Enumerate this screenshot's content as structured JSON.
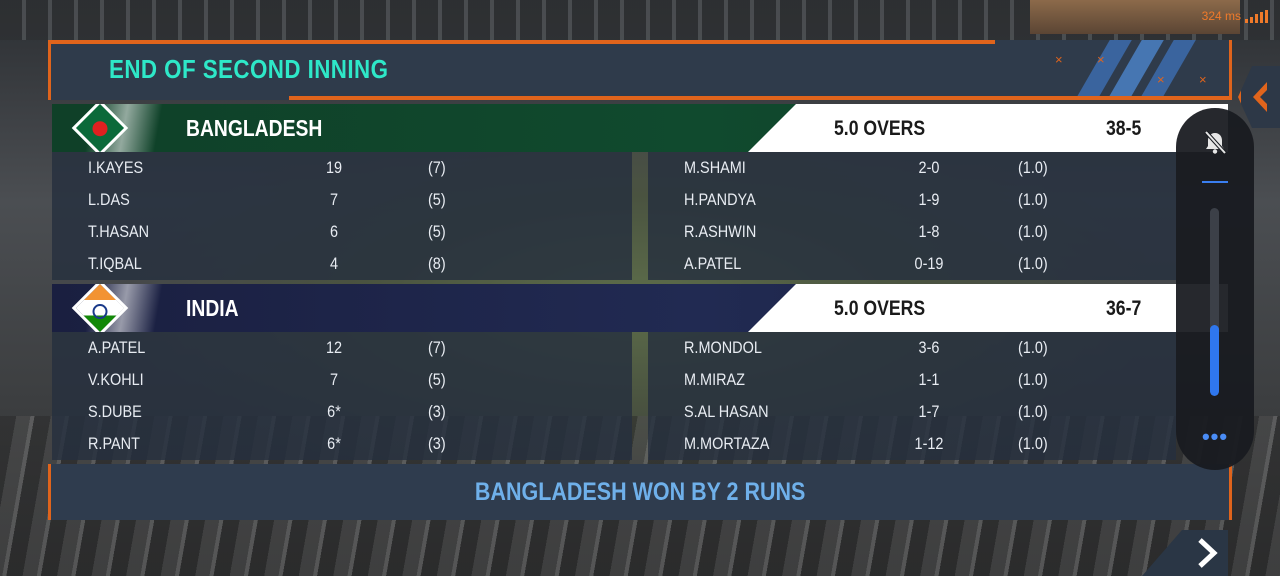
{
  "status": {
    "ping": "324 ms"
  },
  "header": {
    "title": "END OF SECOND INNING"
  },
  "teams": [
    {
      "name": "BANGLADESH",
      "overs": "5.0 OVERS",
      "score": "38-5",
      "flag_icon": "bangladesh-flag-icon",
      "batting": [
        {
          "name": "I.KAYES",
          "runs": "19",
          "balls": "(7)"
        },
        {
          "name": "L.DAS",
          "runs": "7",
          "balls": "(5)"
        },
        {
          "name": "T.HASAN",
          "runs": "6",
          "balls": "(5)"
        },
        {
          "name": "T.IQBAL",
          "runs": "4",
          "balls": "(8)"
        }
      ],
      "bowling": [
        {
          "name": "M.SHAMI",
          "figures": "2-0",
          "overs": "(1.0)"
        },
        {
          "name": "H.PANDYA",
          "figures": "1-9",
          "overs": "(1.0)"
        },
        {
          "name": "R.ASHWIN",
          "figures": "1-8",
          "overs": "(1.0)"
        },
        {
          "name": "A.PATEL",
          "figures": "0-19",
          "overs": "(1.0)"
        }
      ]
    },
    {
      "name": "INDIA",
      "overs": "5.0 OVERS",
      "score": "36-7",
      "flag_icon": "india-flag-icon",
      "batting": [
        {
          "name": "A.PATEL",
          "runs": "12",
          "balls": "(7)"
        },
        {
          "name": "V.KOHLI",
          "runs": "7",
          "balls": "(5)"
        },
        {
          "name": "S.DUBE",
          "runs": "6*",
          "balls": "(3)"
        },
        {
          "name": "R.PANT",
          "runs": "6*",
          "balls": "(3)"
        }
      ],
      "bowling": [
        {
          "name": "R.MONDOL",
          "figures": "3-6",
          "overs": "(1.0)"
        },
        {
          "name": "M.MIRAZ",
          "figures": "1-1",
          "overs": "(1.0)"
        },
        {
          "name": "S.AL HASAN",
          "figures": "1-7",
          "overs": "(1.0)"
        },
        {
          "name": "M.MORTAZA",
          "figures": "1-12",
          "overs": "(1.0)"
        }
      ]
    }
  ],
  "result": {
    "text": "BANGLADESH WON BY 2 RUNS"
  },
  "side_panel": {
    "volume_level": 0.38
  },
  "colors": {
    "accent": "#e0641c",
    "title": "#2ee8c8",
    "result": "#6fb0ea",
    "panel": "#2f3b4b"
  }
}
